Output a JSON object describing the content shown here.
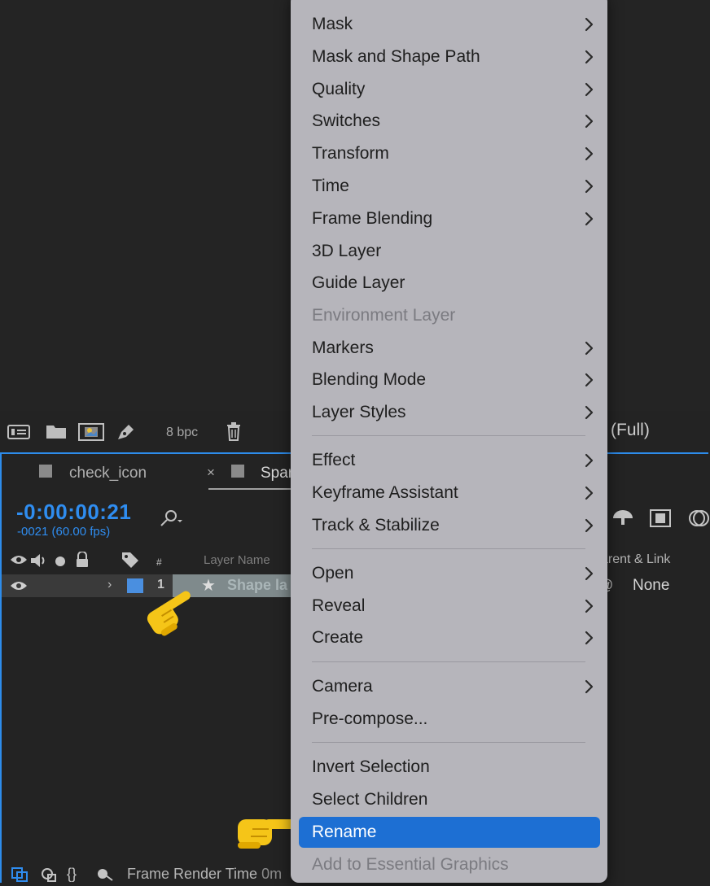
{
  "project_bar": {
    "bpc_label": "8 bpc",
    "resolution_label": "(Full)"
  },
  "timeline": {
    "tabs": [
      {
        "label": "check_icon"
      },
      {
        "label": "Spar"
      }
    ],
    "tab_close_glyph": "×",
    "timecode": "-0:00:00:21",
    "fps_label": "-0021 (60.00 fps)",
    "column_headers": {
      "number": "#",
      "layer_name": "Layer Name",
      "parent_link": "arent & Link"
    },
    "layer": {
      "number": "1",
      "name": "Shape la",
      "parent": "None"
    },
    "footer_label": "Frame Render Time",
    "footer_value": "0m"
  },
  "context_menu": {
    "items": [
      {
        "label": "Mask",
        "submenu": true
      },
      {
        "label": "Mask and Shape Path",
        "submenu": true
      },
      {
        "label": "Quality",
        "submenu": true
      },
      {
        "label": "Switches",
        "submenu": true
      },
      {
        "label": "Transform",
        "submenu": true
      },
      {
        "label": "Time",
        "submenu": true
      },
      {
        "label": "Frame Blending",
        "submenu": true
      },
      {
        "label": "3D Layer",
        "submenu": false
      },
      {
        "label": "Guide Layer",
        "submenu": false
      },
      {
        "label": "Environment Layer",
        "submenu": false,
        "disabled": true
      },
      {
        "label": "Markers",
        "submenu": true
      },
      {
        "label": "Blending Mode",
        "submenu": true
      },
      {
        "label": "Layer Styles",
        "submenu": true
      },
      {
        "label": "Effect",
        "submenu": true
      },
      {
        "label": "Keyframe Assistant",
        "submenu": true
      },
      {
        "label": "Track & Stabilize",
        "submenu": true
      },
      {
        "label": "Open",
        "submenu": true
      },
      {
        "label": "Reveal",
        "submenu": true
      },
      {
        "label": "Create",
        "submenu": true
      },
      {
        "label": "Camera",
        "submenu": true
      },
      {
        "label": "Pre-compose...",
        "submenu": false
      },
      {
        "label": "Invert Selection",
        "submenu": false
      },
      {
        "label": "Select Children",
        "submenu": false
      },
      {
        "label": "Rename",
        "submenu": false,
        "highlighted": true
      },
      {
        "label": "Add to Essential Graphics",
        "submenu": false,
        "disabled": true
      }
    ]
  },
  "colors": {
    "accent": "#2f8df0",
    "menu_bg": "#b6b5bb",
    "menu_highlight": "#1d6fd3",
    "hand_pointer": "#f5c518"
  },
  "icons": [
    "render-queue-icon",
    "folder-icon",
    "composition-icon",
    "pen-icon",
    "trash-icon",
    "search-icon",
    "eye-icon",
    "audio-icon",
    "solo-icon",
    "lock-icon",
    "label-icon",
    "star-icon",
    "chevron-right-icon",
    "pointing-hand-icon"
  ]
}
